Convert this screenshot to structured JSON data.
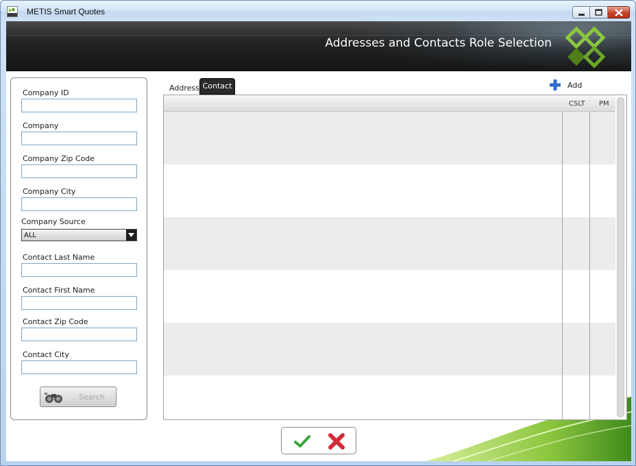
{
  "window": {
    "title": "METIS Smart Quotes"
  },
  "banner": {
    "title": "Addresses and Contacts Role Selection"
  },
  "filters": {
    "company_id_label": "Company ID",
    "company_id_value": "",
    "company_label": "Company",
    "company_value": "",
    "company_zip_label": "Company Zip Code",
    "company_zip_value": "",
    "company_city_label": "Company City",
    "company_city_value": "",
    "company_source_label": "Company Source",
    "company_source_selected": "ALL",
    "contact_last_name_label": "Contact Last Name",
    "contact_last_name_value": "",
    "contact_first_name_label": "Contact First Name",
    "contact_first_name_value": "",
    "contact_zip_label": "Contact Zip Code",
    "contact_zip_value": "",
    "contact_city_label": "Contact City",
    "contact_city_value": "",
    "search_label": "Search"
  },
  "tabs": [
    {
      "label": "Address",
      "active": false
    },
    {
      "label": "Contact",
      "active": true
    }
  ],
  "toolbar": {
    "add_label": "Add"
  },
  "grid": {
    "columns": [
      "",
      "CSLT",
      "PM"
    ],
    "rows": [
      {
        "cells": [
          "",
          "",
          ""
        ]
      },
      {
        "cells": [
          "",
          "",
          ""
        ]
      },
      {
        "cells": [
          "",
          "",
          ""
        ]
      },
      {
        "cells": [
          "",
          "",
          ""
        ]
      },
      {
        "cells": [
          "",
          "",
          ""
        ]
      },
      {
        "cells": [
          "",
          "",
          ""
        ]
      }
    ]
  },
  "colors": {
    "banner_dark": "#1a1a1a",
    "accent_green": "#8cc63f",
    "logo_green": "#5a8f1f",
    "add_icon_blue": "#2f6fd1",
    "ok_green": "#3aa53a",
    "cancel_red": "#d42b3a"
  },
  "icons": {
    "app": "metis-logo-icon",
    "minimize": "minimize-icon",
    "maximize": "maximize-icon",
    "close": "close-icon",
    "search": "binoculars-icon",
    "add": "plus-icon",
    "ok": "checkmark-icon",
    "cancel": "cross-icon",
    "dropdown": "chevron-down-icon"
  }
}
